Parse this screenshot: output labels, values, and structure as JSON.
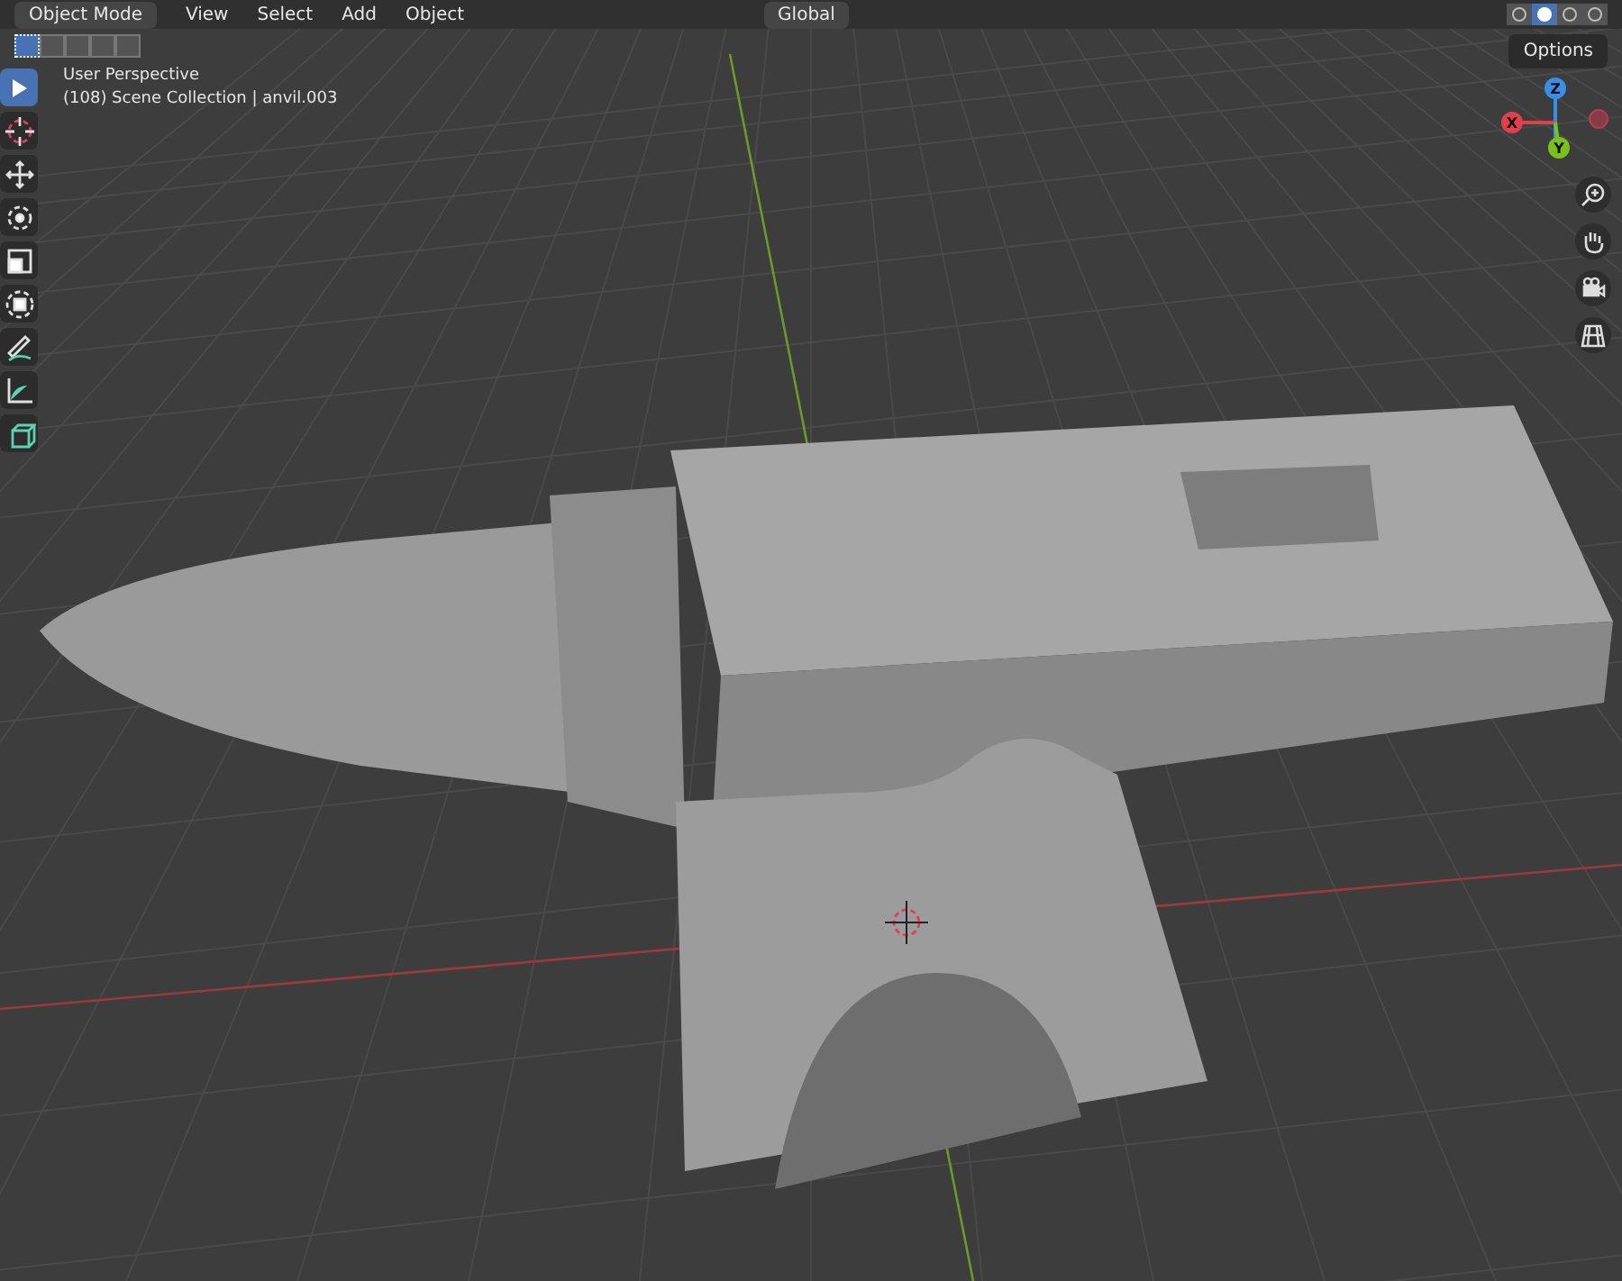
{
  "header": {
    "mode": "Object Mode",
    "menus": [
      "View",
      "Select",
      "Add",
      "Object"
    ],
    "orientation": "Global"
  },
  "select_modes": [
    {
      "selected": true
    },
    {
      "selected": false
    },
    {
      "selected": false
    },
    {
      "selected": false
    },
    {
      "selected": false
    }
  ],
  "shading_modes": [
    {
      "selected": false
    },
    {
      "selected": true
    },
    {
      "selected": false
    },
    {
      "selected": false
    }
  ],
  "options": "Options",
  "viewport_info": {
    "view": "User Perspective",
    "object": "(108) Scene Collection | anvil.003"
  },
  "tools": [
    {
      "kind": "select",
      "selected": true
    },
    {
      "kind": "cursor",
      "selected": false
    },
    {
      "kind": "move",
      "selected": false
    },
    {
      "kind": "rotate",
      "selected": false
    },
    {
      "kind": "scale",
      "selected": false
    },
    {
      "kind": "transform",
      "selected": false
    },
    {
      "kind": "annotate",
      "selected": false
    },
    {
      "kind": "measure",
      "selected": false
    },
    {
      "kind": "add-cube",
      "selected": false
    }
  ],
  "gizmo": {
    "x": "X",
    "y": "Y",
    "z": "Z"
  },
  "nav_buttons": [
    {
      "kind": "zoom"
    },
    {
      "kind": "pan"
    },
    {
      "kind": "camera"
    },
    {
      "kind": "ortho"
    }
  ]
}
